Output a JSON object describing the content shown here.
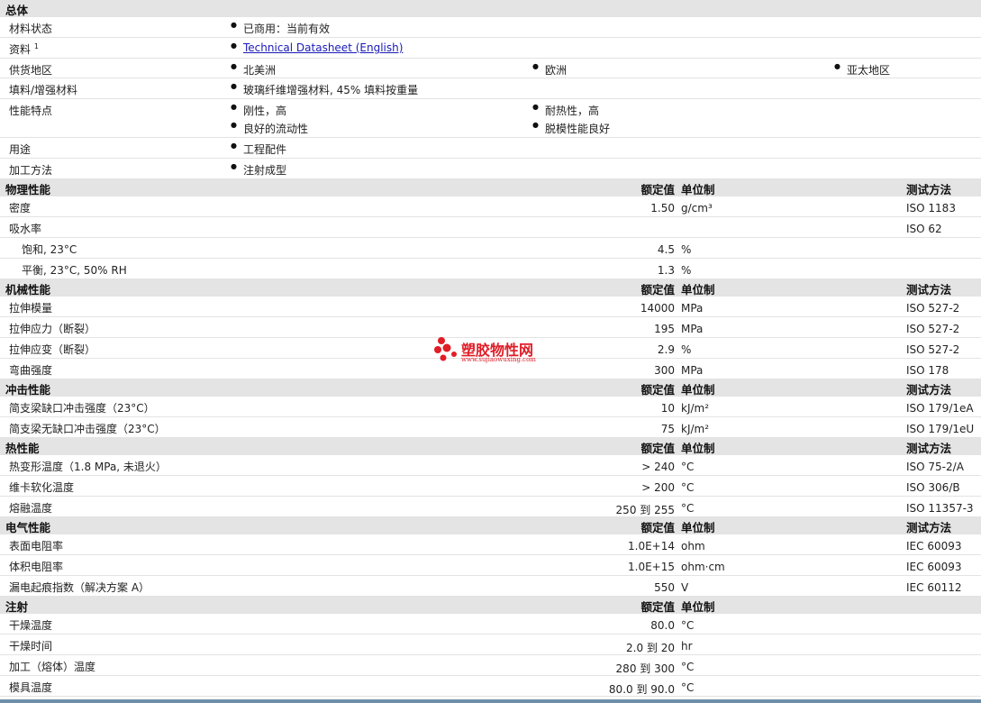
{
  "general": {
    "title": "总体",
    "material_status": {
      "label": "材料状态",
      "value": "已商用：当前有效"
    },
    "documents": {
      "label": "资料",
      "sup": "1",
      "link": "Technical Datasheet (English)"
    },
    "availability": {
      "label": "供货地区",
      "values": [
        "北美洲",
        "欧洲",
        "亚太地区"
      ]
    },
    "filler": {
      "label": "填料/增强材料",
      "value": "玻璃纤维增强材料, 45% 填料按重量"
    },
    "features": {
      "label": "性能特点",
      "values": [
        "刚性，高",
        "耐热性，高",
        "良好的流动性",
        "脱模性能良好"
      ]
    },
    "uses": {
      "label": "用途",
      "value": "工程配件"
    },
    "processing": {
      "label": "加工方法",
      "value": "注射成型"
    }
  },
  "columns": {
    "nominal": "额定值",
    "unit": "单位制",
    "method": "测试方法"
  },
  "sections": {
    "physical": {
      "title": "物理性能",
      "rows": [
        {
          "label": "密度",
          "value": "1.50",
          "unit": "g/cm³",
          "method": "ISO 1183"
        },
        {
          "label": "吸水率",
          "value": "",
          "unit": "",
          "method": "ISO 62"
        },
        {
          "label": "饱和, 23°C",
          "value": "4.5",
          "unit": "%",
          "method": ""
        },
        {
          "label": "平衡, 23°C, 50% RH",
          "value": "1.3",
          "unit": "%",
          "method": ""
        }
      ]
    },
    "mechanical": {
      "title": "机械性能",
      "rows": [
        {
          "label": "拉伸模量",
          "value": "14000",
          "unit": "MPa",
          "method": "ISO 527-2"
        },
        {
          "label": "拉伸应力（断裂）",
          "value": "195",
          "unit": "MPa",
          "method": "ISO 527-2"
        },
        {
          "label": "拉伸应变（断裂）",
          "value": "2.9",
          "unit": "%",
          "method": "ISO 527-2"
        },
        {
          "label": "弯曲强度",
          "value": "300",
          "unit": "MPa",
          "method": "ISO 178"
        }
      ]
    },
    "impact": {
      "title": "冲击性能",
      "rows": [
        {
          "label": "简支梁缺口冲击强度（23°C）",
          "value": "10",
          "unit": "kJ/m²",
          "method": "ISO 179/1eA"
        },
        {
          "label": "简支梁无缺口冲击强度（23°C）",
          "value": "75",
          "unit": "kJ/m²",
          "method": "ISO 179/1eU"
        }
      ]
    },
    "thermal": {
      "title": "热性能",
      "rows": [
        {
          "label": "热变形温度（1.8 MPa, 未退火）",
          "value": "> 240",
          "unit": "°C",
          "method": "ISO 75-2/A"
        },
        {
          "label": "维卡软化温度",
          "value": "> 200",
          "unit": "°C",
          "method": "ISO 306/B"
        },
        {
          "label": "熔融温度",
          "value": "250 到 255",
          "unit": "°C",
          "method": "ISO 11357-3"
        }
      ]
    },
    "electrical": {
      "title": "电气性能",
      "rows": [
        {
          "label": "表面电阻率",
          "value": "1.0E+14",
          "unit": "ohm",
          "method": "IEC 60093"
        },
        {
          "label": "体积电阻率",
          "value": "1.0E+15",
          "unit": "ohm·cm",
          "method": "IEC 60093"
        },
        {
          "label": "漏电起痕指数（解决方案 A）",
          "value": "550",
          "unit": "V",
          "method": "IEC 60112"
        }
      ]
    },
    "injection": {
      "title": "注射",
      "rows": [
        {
          "label": "干燥温度",
          "value": "80.0",
          "unit": "°C"
        },
        {
          "label": "干燥时间",
          "value": "2.0 到 20",
          "unit": "hr"
        },
        {
          "label": "加工（熔体）温度",
          "value": "280 到 300",
          "unit": "°C"
        },
        {
          "label": "模具温度",
          "value": "80.0 到 90.0",
          "unit": "°C"
        }
      ]
    }
  },
  "watermark": {
    "text": "塑胶物性网",
    "url": "www.sujiaowuxing.com",
    "color": "#e01c26"
  }
}
